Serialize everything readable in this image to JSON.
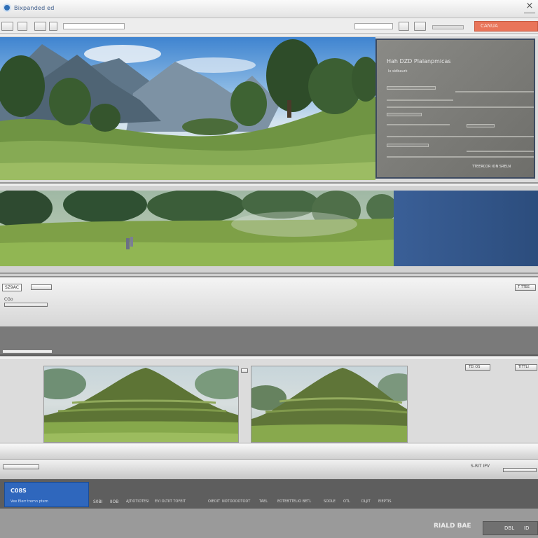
{
  "window": {
    "title": "Bixpanded ed",
    "close_glyph": "×",
    "accent_button": "CANUA"
  },
  "toolbar": {
    "buttons": [
      "btn-1",
      "btn-2",
      "btn-3",
      "btn-4",
      "btn-5",
      "btn-6"
    ]
  },
  "inspector": {
    "title": "Hah  DZD Plalanpmicas",
    "subtitle": "Ix  sidbaurk",
    "footer_text": "TTEERCOR ION  SRELN"
  },
  "properties": {
    "header_label": "SZ9AC",
    "field_label": "CGo",
    "right_button": "T  TTEE"
  },
  "compare": {
    "right_buttons": [
      "TEI OS",
      "TITTLI"
    ]
  },
  "statusbar": {
    "right_label": "S-RIT IPV"
  },
  "timeline": {
    "card_title": "C08S",
    "card_subtitle": "Vee  Elerr  tremn  ptem",
    "items": [
      "S0BI",
      "IIOB",
      "AJTIOTIOTESI",
      "EVI OLTIIT TOFEIT",
      "OIEOIT",
      "NOTODOOTODT",
      "TAEL",
      "EOTEBTTELIO BETL",
      "SODLE",
      "OTL",
      "DLJIT",
      "EIEPTIS"
    ]
  },
  "footer": {
    "label": "RIALD BAE",
    "button_left": "DBL",
    "button_right": "ID"
  },
  "colors": {
    "accent": "#e9755a",
    "brand_blue": "#2f67bd",
    "panel_blue": "#3a5f97"
  }
}
